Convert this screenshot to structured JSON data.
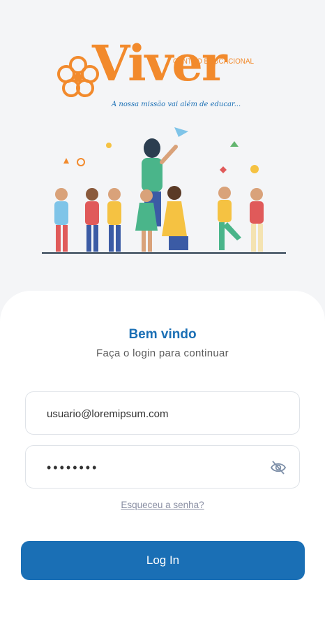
{
  "brand": {
    "name": "Viver",
    "superscript": "CENTRO EDUCACIONAL",
    "tagline": "A nossa missão vai além de educar..."
  },
  "login": {
    "title": "Bem vindo",
    "subtitle": "Faça o login para continuar",
    "email_value": "usuario@loremipsum.com",
    "password_value": "••••••••",
    "forgot_label": "Esqueceu a senha?",
    "submit_label": "Log In"
  },
  "icons": {
    "password_toggle": "eye-off-icon",
    "logo_flower": "flower-icon"
  },
  "colors": {
    "primary": "#1a6fb5",
    "brand_orange": "#f28a2c",
    "background": "#f4f5f7"
  }
}
